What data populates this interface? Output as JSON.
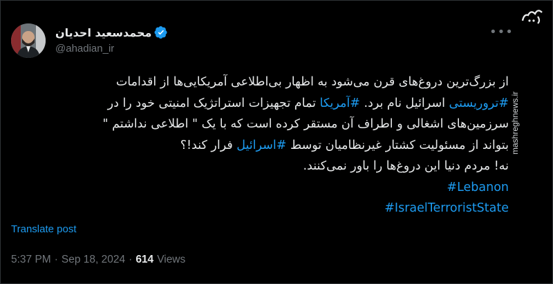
{
  "author": {
    "display_name": "محمدسعید احدیان",
    "handle": "@ahadian_ir",
    "verified": true
  },
  "tweet": {
    "lines": [
      {
        "parts": [
          {
            "text": "از بزرگ‌ترین دروغ‌های قرن می‌شود به اظهار بی‌اطلاعی آمریکایی‌ها از اقدامات",
            "type": "text"
          }
        ]
      },
      {
        "parts": [
          {
            "text": "#تروریستی",
            "type": "hashtag"
          },
          {
            "text": " اسرائیل نام برد. ",
            "type": "text"
          },
          {
            "text": "#آمریکا",
            "type": "hashtag"
          },
          {
            "text": " تمام تجهیزات استراتژیک امنیتی خود را در",
            "type": "text"
          }
        ]
      },
      {
        "parts": [
          {
            "text": "سرزمین‌های اشغالی و اطراف آن مستقر کرده است که با یک \" اطلاعی نداشتم \"",
            "type": "text"
          }
        ]
      },
      {
        "parts": [
          {
            "text": "بتواند از مسئولیت کشتار غیرنظامیان توسط ",
            "type": "text"
          },
          {
            "text": "#اسرائیل",
            "type": "hashtag"
          },
          {
            "text": " فرار کند!؟",
            "type": "text"
          }
        ]
      },
      {
        "parts": [
          {
            "text": "نه! مردم دنیا این دروغ‌ها را باور نمی‌کنند.",
            "type": "text"
          }
        ]
      },
      {
        "parts": [
          {
            "text": "#Lebanon",
            "type": "hashtag"
          }
        ]
      },
      {
        "parts": [
          {
            "text": "#IsraelTerroristState",
            "type": "hashtag"
          }
        ]
      }
    ]
  },
  "translate_label": "Translate post",
  "meta": {
    "time": "5:37 PM",
    "separator": "·",
    "date": "Sep 18, 2024",
    "views_count": "614",
    "views_label": "Views"
  },
  "watermark": {
    "url": "mashreghnews.ir"
  },
  "icons": {
    "verified": "verified-badge-icon",
    "more": "more-options-icon"
  },
  "colors": {
    "background": "#000000",
    "text": "#e7e9ea",
    "muted": "#71767b",
    "accent": "#1d9bf0"
  }
}
